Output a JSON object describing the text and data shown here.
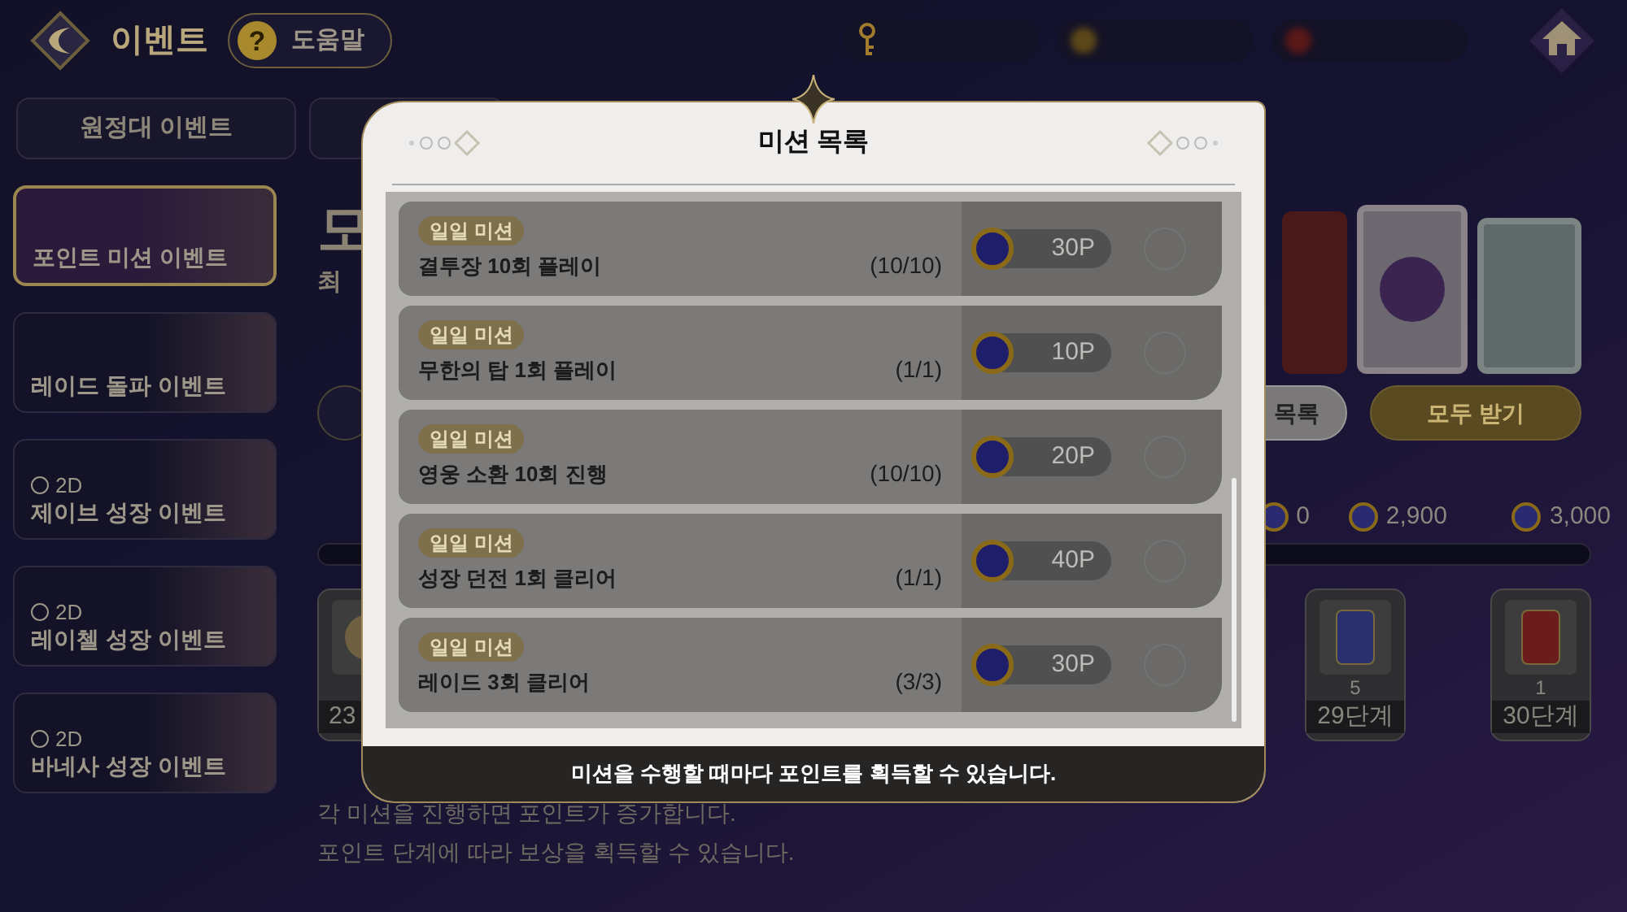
{
  "header": {
    "title": "이벤트",
    "help": "도움말",
    "help_icon": "?"
  },
  "tabs": [
    {
      "label": "원정대 이벤트",
      "selected": false
    }
  ],
  "sidebar": {
    "items": [
      {
        "label": "포인트 미션 이벤트",
        "selected": true
      },
      {
        "label": "레이드 돌파 이벤트",
        "selected": false
      },
      {
        "label": "제이브 성장 이벤트",
        "timer": "2D",
        "selected": false
      },
      {
        "label": "레이첼 성장 이벤트",
        "timer": "2D",
        "selected": false
      },
      {
        "label": "바네사 성장 이벤트",
        "timer": "2D",
        "selected": false
      }
    ]
  },
  "main": {
    "heading": "모",
    "subtitle": "최",
    "buttons": [
      {
        "label": "목록",
        "kind": "list"
      },
      {
        "label": "모두 받기",
        "kind": "claim"
      }
    ],
    "milestones": [
      "0",
      "2,900",
      "3,000"
    ],
    "rewards": [
      {
        "stage": "23"
      },
      {
        "count": "5",
        "stage": "29단계",
        "color": "#2a2f6e"
      },
      {
        "count": "1",
        "stage": "30단계",
        "color": "#6b1d1d"
      }
    ],
    "notes": [
      "각 미션을 진행하면 포인트가 증가합니다.",
      "포인트 단계에 따라 보상을 획득할 수 있습니다."
    ]
  },
  "modal": {
    "title": "미션 목록",
    "missions": [
      {
        "tag": "일일 미션",
        "name": "결투장 10회 플레이",
        "progress": "(10/10)",
        "reward": "30P",
        "completed": true
      },
      {
        "tag": "일일 미션",
        "name": "무한의 탑 1회 플레이",
        "progress": "(1/1)",
        "reward": "10P",
        "completed": true
      },
      {
        "tag": "일일 미션",
        "name": "영웅 소환 10회 진행",
        "progress": "(10/10)",
        "reward": "20P",
        "completed": true
      },
      {
        "tag": "일일 미션",
        "name": "성장 던전 1회 클리어",
        "progress": "(1/1)",
        "reward": "40P",
        "completed": true
      },
      {
        "tag": "일일 미션",
        "name": "레이드 3회 클리어",
        "progress": "(3/3)",
        "reward": "30P",
        "completed": true
      }
    ],
    "footer": "미션을 수행할 때마다 포인트를 획득할 수 있습니다."
  }
}
